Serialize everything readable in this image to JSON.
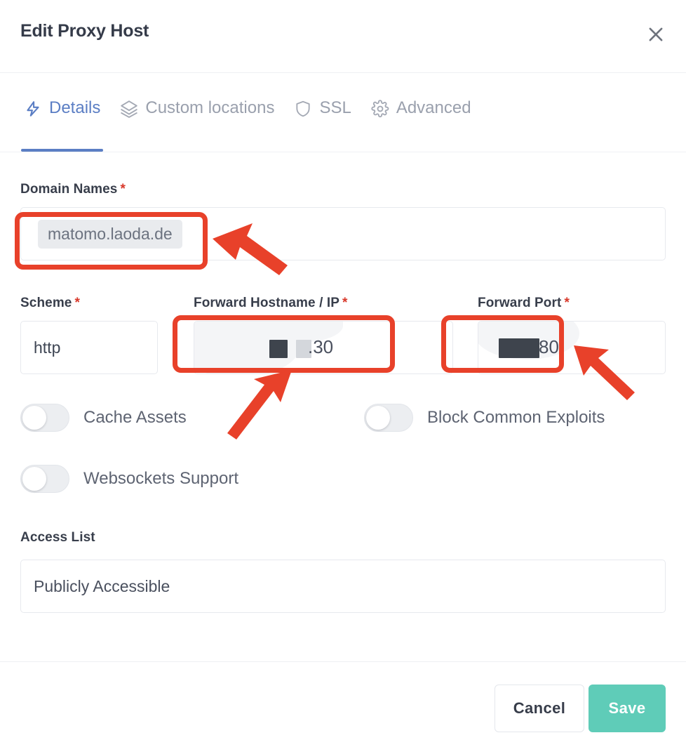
{
  "header": {
    "title": "Edit Proxy Host",
    "close_icon": "close-icon"
  },
  "tabs": [
    {
      "label": "Details",
      "icon": "zap-icon",
      "active": true
    },
    {
      "label": "Custom locations",
      "icon": "layers-icon",
      "active": false
    },
    {
      "label": "SSL",
      "icon": "shield-icon",
      "active": false
    },
    {
      "label": "Advanced",
      "icon": "gear-icon",
      "active": false
    }
  ],
  "form": {
    "domain_names": {
      "label": "Domain Names",
      "required_marker": "*",
      "tags": [
        "matomo.laoda.de"
      ]
    },
    "scheme": {
      "label": "Scheme",
      "required_marker": "*",
      "value": "http"
    },
    "forward_hostname": {
      "label": "Forward Hostname / IP",
      "required_marker": "*",
      "value": ".30",
      "redacted": true
    },
    "forward_port": {
      "label": "Forward Port",
      "required_marker": "*",
      "value": "80",
      "redacted": true
    },
    "toggles": [
      {
        "label": "Cache Assets",
        "on": false
      },
      {
        "label": "Block Common Exploits",
        "on": false
      },
      {
        "label": "Websockets Support",
        "on": false
      }
    ],
    "access_list": {
      "label": "Access List",
      "value": "Publicly Accessible"
    }
  },
  "footer": {
    "cancel_label": "Cancel",
    "save_label": "Save"
  },
  "annotations": {
    "highlight_color": "#e8412a",
    "boxes": [
      "domain-names-field",
      "forward-hostname-field",
      "forward-port-field"
    ],
    "arrows": [
      "arrow-to-domain-names",
      "arrow-to-forward-hostname",
      "arrow-to-forward-port"
    ]
  },
  "colors": {
    "accent_tab": "#5b7ec4",
    "save_button": "#5fccb8",
    "required_star": "#d8382a",
    "annotation_red": "#e8412a"
  }
}
